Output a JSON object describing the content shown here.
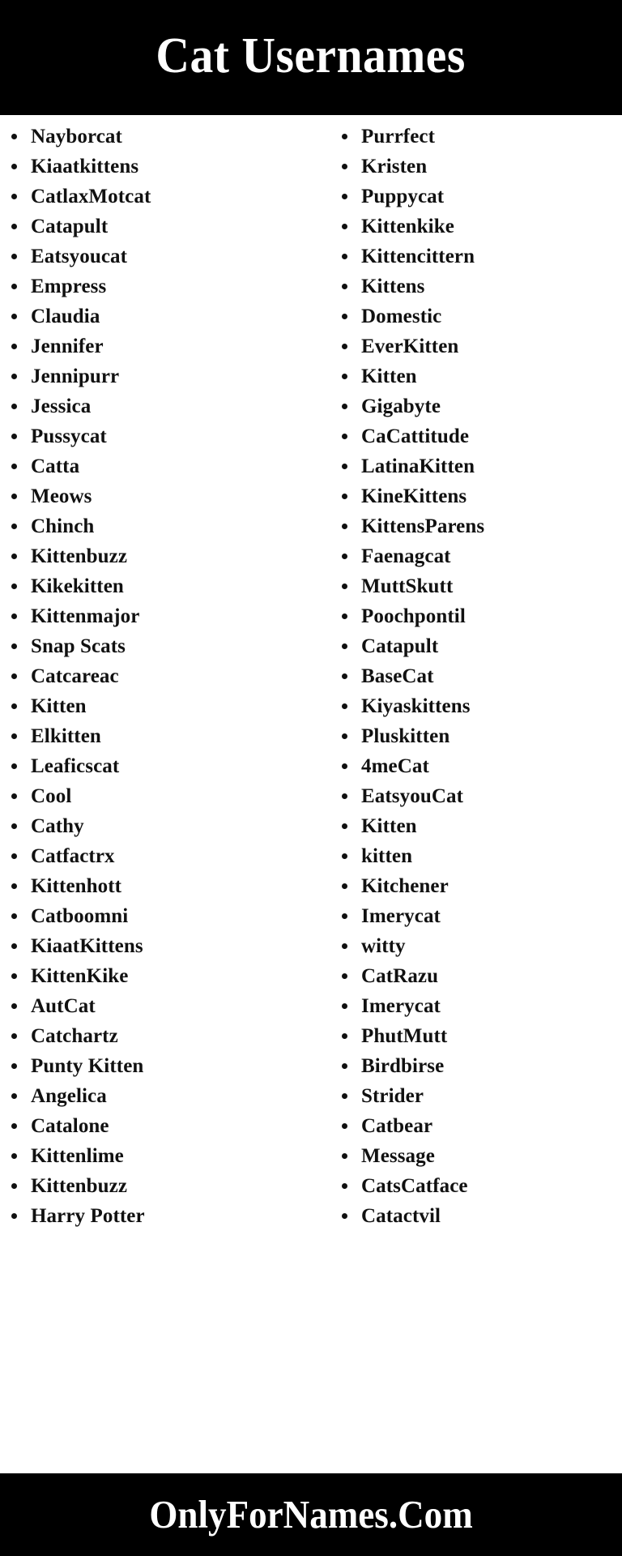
{
  "header": {
    "title": "Cat Usernames",
    "background_color": "#000000",
    "text_color": "#ffffff"
  },
  "footer": {
    "site": "OnlyForNames.Com",
    "background_color": "#000000",
    "text_color": "#ffffff"
  },
  "content": {
    "background_color": "#ffffff",
    "text_color": "#111111",
    "bullet": "•",
    "columns": [
      {
        "id": "left",
        "items": [
          "Nayborcat",
          "Kiaatkittens",
          "CatlaxMotcat",
          "Catapult",
          "Eatsyoucat",
          "Empress",
          "Claudia",
          "Jennifer",
          "Jennipurr",
          "Jessica",
          "Pussycat",
          "Catta",
          "Meows",
          "Chinch",
          "Kittenbuzz",
          "Kikekitten",
          "Kittenmajor",
          "Snap Scats",
          "Catcareac",
          "Kitten",
          "Elkitten",
          "Leaficscat",
          "Cool",
          "Cathy",
          "Catfactrx",
          "Kittenhott",
          "Catboomni",
          "KiaatKittens",
          "KittenKike",
          "AutCat",
          "Catchartz",
          "Punty Kitten",
          "Angelica",
          "Catalone",
          "Kittenlime",
          "Kittenbuzz",
          "Harry Potter"
        ]
      },
      {
        "id": "right",
        "items": [
          "Purrfect",
          "Kristen",
          "Puppycat",
          "Kittenkike",
          "Kittencittern",
          "Kittens",
          "Domestic",
          "EverKitten",
          "Kitten",
          "Gigabyte",
          "CaCattitude",
          "LatinaKitten",
          "KineKittens",
          "KittensParens",
          "Faenagcat",
          "MuttSkutt",
          "Poochpontil",
          "Catapult",
          "BaseCat",
          "Kiyaskittens",
          "Pluskitten",
          "4meCat",
          "EatsyouCat",
          "Kitten",
          "kitten",
          "Kitchener",
          "Imerycat",
          "witty",
          "CatRazu",
          "Imerycat",
          "PhutMutt",
          "Birdbirse",
          "Strider",
          "Catbear",
          "Message",
          "CatsCatface",
          "Catactvil"
        ]
      }
    ]
  }
}
